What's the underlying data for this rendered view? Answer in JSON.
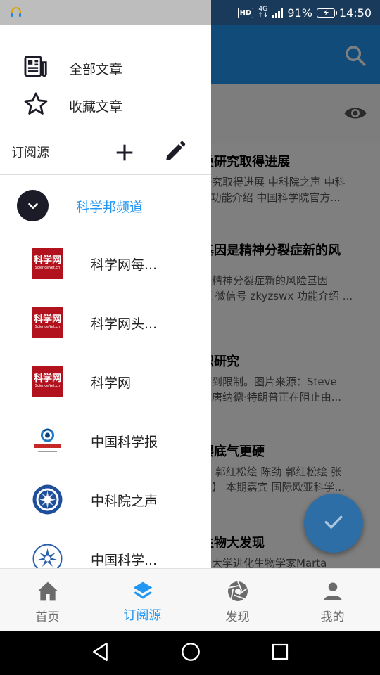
{
  "status_bar": {
    "hd": "HD",
    "network": "4G",
    "battery": "91%",
    "time": "14:50"
  },
  "background": {
    "articles": [
      {
        "title": "叠研究取得进展",
        "snippet_1": "研究取得进展 中科院之声 中科",
        "snippet_2": "x 功能介绍 中国科学院官方..."
      },
      {
        "title": "基因是精神分裂症新的风",
        "snippet_1": "是精神分裂症新的风险基因",
        "snippet_2": "源 微信号 zkyzswx 功能介绍 ..."
      },
      {
        "title": "积研究",
        "snippet_1": "受到限制。图片来源：Steve",
        "snippet_2": "统唐纳德·特朗普正在阻止由..."
      },
      {
        "title": "展底气更硬",
        "snippet_1": "宇 郭红松绘 陈劲 郭红松绘 张",
        "snippet_2": "问】 本期嘉宾 国际欧亚科学..."
      },
      {
        "title": "生物大发现",
        "snippet_1": "纳大学进化生物学家Marta",
        "snippet_2": ""
      }
    ]
  },
  "drawer": {
    "all_articles": "全部文章",
    "starred_articles": "收藏文章",
    "subscriptions_header": "订阅源",
    "group_name": "科学邦频道",
    "sources": [
      {
        "name": "科学网每...",
        "logo": "sciencenet"
      },
      {
        "name": "科学网头...",
        "logo": "sciencenet"
      },
      {
        "name": "科学网",
        "logo": "sciencenet"
      },
      {
        "name": "中国科学报",
        "logo": "cas-news"
      },
      {
        "name": "中科院之声",
        "logo": "cas-voice"
      },
      {
        "name": "中国科学...",
        "logo": "cas-emblem"
      }
    ],
    "sciencenet_logo": {
      "cn": "科学网",
      "en": "ScienceNet.cn"
    }
  },
  "bottom_nav": {
    "tabs": [
      {
        "label": "首页",
        "icon": "home-icon",
        "active": false
      },
      {
        "label": "订阅源",
        "icon": "layers-icon",
        "active": true
      },
      {
        "label": "发现",
        "icon": "aperture-icon",
        "active": false
      },
      {
        "label": "我的",
        "icon": "person-icon",
        "active": false
      }
    ]
  },
  "colors": {
    "primary": "#2196f3",
    "fab": "#2e6ea6",
    "sciencenet_red": "#b1121d"
  }
}
